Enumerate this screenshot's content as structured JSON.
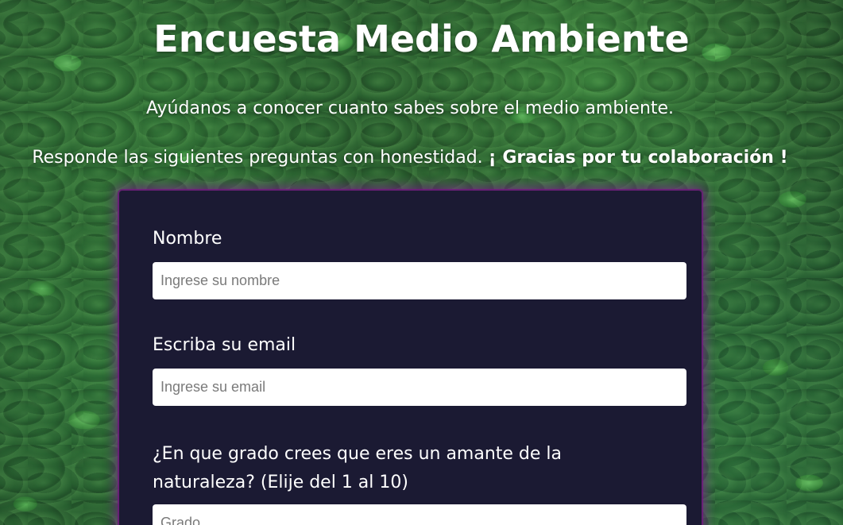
{
  "header": {
    "title": "Encuesta Medio Ambiente",
    "subtitle_line1": "Ayúdanos a conocer cuanto sabes sobre el medio ambiente.",
    "subtitle_line2_prefix": "Responde las siguientes preguntas con honestidad. ",
    "subtitle_line2_bold": "¡ Gracias por tu colaboración !"
  },
  "form": {
    "name": {
      "label": "Nombre",
      "placeholder": "Ingrese su nombre",
      "value": ""
    },
    "email": {
      "label": "Escriba su email",
      "placeholder": "Ingrese su email",
      "value": ""
    },
    "grade": {
      "label": "¿En que grado crees que eres un amante de la naturaleza? (Elije del 1 al 10)",
      "placeholder": "Grado",
      "value": ""
    }
  },
  "colors": {
    "card_background": "#1b1a33",
    "card_glow": "#84189a",
    "text": "#ffffff",
    "background": "#2f6b33"
  }
}
